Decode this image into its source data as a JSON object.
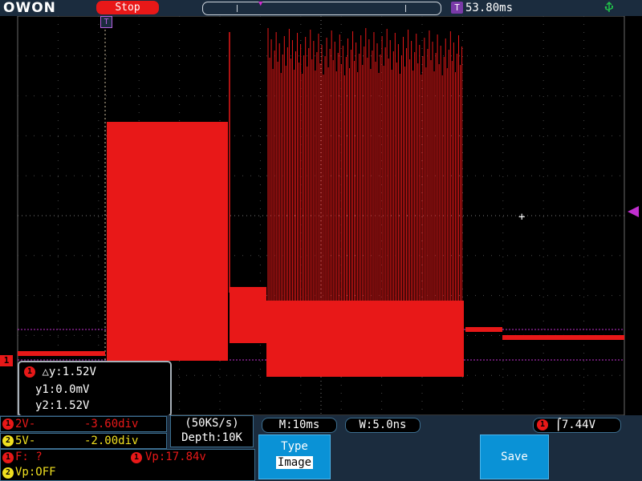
{
  "brand": {
    "logo": "OWON"
  },
  "status": {
    "run_state": "Stop",
    "trigger_time_icon": "T",
    "trigger_time": "53.80ms",
    "usb_icon": "usb-icon"
  },
  "channel1": {
    "marker": "1",
    "color": "#e81818"
  },
  "trigger": {
    "top_marker": "T",
    "level_arrow_color": "#c22fd0"
  },
  "cursor_readout": {
    "channel_badge": "1",
    "delta_y": "△y:1.52V",
    "y1": "y1:0.0mV",
    "y2": "y2:1.52V"
  },
  "channels": [
    {
      "badge": "1",
      "scale": "2V-",
      "offset": "-3.60div",
      "color": "#e81818"
    },
    {
      "badge": "2",
      "scale": "5V-",
      "offset": "-2.00div",
      "color": "#f0e020"
    }
  ],
  "acquisition": {
    "sample_rate": "(50KS/s)",
    "depth": "Depth:10K"
  },
  "horizontal": {
    "timebase": "M:10ms",
    "window": "W:5.0ns"
  },
  "trigger_readout": {
    "badge": "1",
    "edge_icon": "rising-edge-icon",
    "edge_glyph": "⌠",
    "level": "7.44V"
  },
  "measurements": {
    "ch1_badge": "1",
    "freq": "F:  ?",
    "vp_badge": "1",
    "vp": "Vp:17.84v",
    "ch2_badge": "2",
    "ch2_vp": "Vp:OFF"
  },
  "menu": {
    "type_label": "Type",
    "type_value": "Image",
    "save_label": "Save"
  }
}
